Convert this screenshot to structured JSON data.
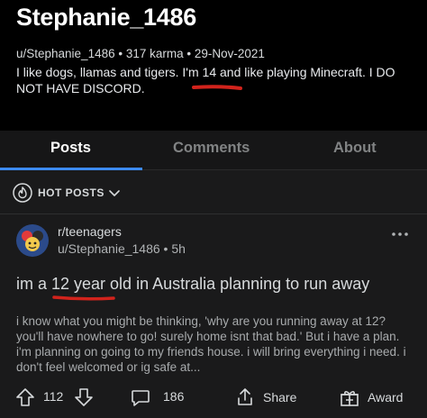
{
  "profile": {
    "username": "Stephanie_1486",
    "meta": "u/Stephanie_1486 • 317 karma • 29-Nov-2021",
    "bio": "I like dogs, llamas and tigers. I'm 14 and like playing Minecraft. I DO NOT HAVE DISCORD."
  },
  "tabs": [
    {
      "label": "Posts"
    },
    {
      "label": "Comments"
    },
    {
      "label": "About"
    }
  ],
  "sort": {
    "label": "HOT POSTS"
  },
  "post": {
    "subreddit": "r/teenagers",
    "meta": "u/Stephanie_1486 • 5h",
    "title": "im a 12 year old in Australia planning to run away",
    "body": "i know what you might be thinking, 'why are you running away at 12? you'll have nowhere to go! surely home isnt that bad.' But i have a plan. i'm planning on going to my friends house. i will bring everything i need. i don't feel welcomed or ig safe at...",
    "score": "112",
    "comments": "186",
    "share_label": "Share",
    "award_label": "Award"
  },
  "colors": {
    "accent_blue": "#3d8bf7",
    "annotation_red": "#d2231c",
    "page_bg": "#000000",
    "card_bg": "#1a1a1b"
  }
}
